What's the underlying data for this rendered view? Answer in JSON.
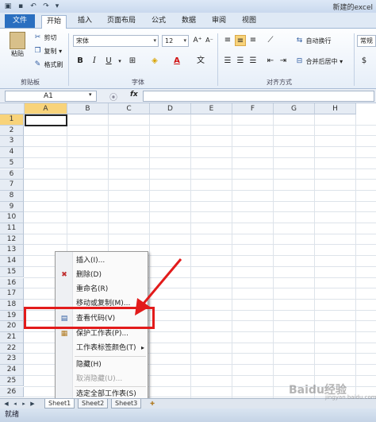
{
  "window": {
    "title": "新建的excel"
  },
  "ribbon_tabs": [
    {
      "label": "文件"
    },
    {
      "label": "开始"
    },
    {
      "label": "插入"
    },
    {
      "label": "页面布局"
    },
    {
      "label": "公式"
    },
    {
      "label": "数据"
    },
    {
      "label": "审阅"
    },
    {
      "label": "视图"
    }
  ],
  "clipboard": {
    "paste": "粘贴",
    "cut": "剪切",
    "copy": "复制",
    "format_painter": "格式刷",
    "group": "剪贴板"
  },
  "font": {
    "name": "宋体",
    "size": "12",
    "bold": "B",
    "italic": "I",
    "underline": "U",
    "group": "字体"
  },
  "alignment": {
    "wrap": "自动换行",
    "merge": "合并后居中",
    "group": "对齐方式"
  },
  "number": {
    "format": "常规"
  },
  "formula_bar": {
    "name_box": "A1",
    "fx": "fx"
  },
  "columns": [
    "A",
    "B",
    "C",
    "D",
    "E",
    "F",
    "G",
    "H"
  ],
  "rows": [
    "1",
    "2",
    "3",
    "4",
    "5",
    "6",
    "7",
    "8",
    "9",
    "10",
    "11",
    "12",
    "13",
    "14",
    "15",
    "16",
    "17",
    "18",
    "19",
    "20",
    "21",
    "22",
    "23",
    "24",
    "25",
    "26"
  ],
  "context_menu": {
    "items": [
      {
        "label": "插入(I)..."
      },
      {
        "label": "删除(D)"
      },
      {
        "label": "重命名(R)"
      },
      {
        "label": "移动或复制(M)..."
      },
      {
        "label": "查看代码(V)"
      },
      {
        "label": "保护工作表(P)..."
      },
      {
        "label": "工作表标签颜色(T)"
      },
      {
        "label": "隐藏(H)"
      },
      {
        "label": "取消隐藏(U)..."
      },
      {
        "label": "选定全部工作表(S)"
      }
    ]
  },
  "sheet_tabs": [
    {
      "label": "Sheet1"
    },
    {
      "label": "Sheet2"
    },
    {
      "label": "Sheet3"
    }
  ],
  "status": {
    "text": "就绪"
  },
  "watermark": {
    "text": "Baidu经验",
    "sub": "jingyan.baidu.com"
  },
  "colors": {
    "file_tab": "#2a6fc0",
    "highlight": "#e21b1b",
    "selected_header": "#f8d37a"
  }
}
